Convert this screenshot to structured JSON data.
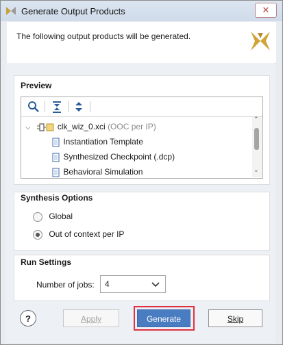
{
  "window": {
    "title": "Generate Output Products",
    "close_glyph": "✕"
  },
  "banner": {
    "message": "The following output products will be generated."
  },
  "preview": {
    "heading": "Preview",
    "toolbar_icons": [
      "search-icon",
      "collapse-all-icon",
      "expand-all-icon"
    ],
    "tree": {
      "root": {
        "name": "clk_wiz_0.xci",
        "suffix": "(OOC per IP)"
      },
      "children": [
        "Instantiation Template",
        "Synthesized Checkpoint (.dcp)",
        "Behavioral Simulation"
      ]
    }
  },
  "synthesis": {
    "heading": "Synthesis Options",
    "options": [
      "Global",
      "Out of context per IP"
    ],
    "selected": "Out of context per IP"
  },
  "run_settings": {
    "heading": "Run Settings",
    "jobs_label": "Number of jobs:",
    "jobs_value": "4"
  },
  "buttons": {
    "help": "?",
    "apply": "Apply",
    "generate": "Generate",
    "skip": "Skip"
  },
  "colors": {
    "generate_bg": "#4a7cc1",
    "highlight_border": "#e03040",
    "accent": "#cfa53a"
  }
}
